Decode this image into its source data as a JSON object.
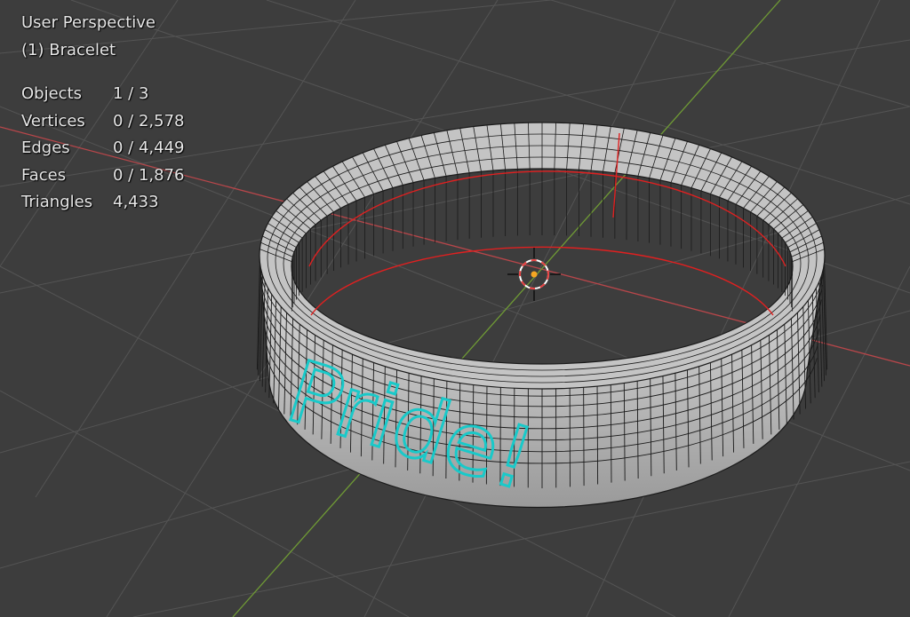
{
  "viewport": {
    "perspective_label": "User Perspective",
    "active_object": "(1) Bracelet"
  },
  "stats": [
    {
      "label": "Objects",
      "value": "1 / 3"
    },
    {
      "label": "Vertices",
      "value": "0 / 2,578"
    },
    {
      "label": "Edges",
      "value": "0 / 4,449"
    },
    {
      "label": "Faces",
      "value": "0 / 1,876"
    },
    {
      "label": "Triangles",
      "value": "4,433"
    }
  ],
  "model": {
    "engraved_text": "Pride!",
    "mesh_color": "#c8c8c8",
    "wire_color": "#1a1a1a",
    "seam_color": "#e02020",
    "text_outline_color": "#19c9c9"
  },
  "colors": {
    "background": "#3d3d3d",
    "grid": "#545454",
    "x_axis": "#b8464a",
    "y_axis": "#6f9a35",
    "cursor_red": "#e84040"
  }
}
